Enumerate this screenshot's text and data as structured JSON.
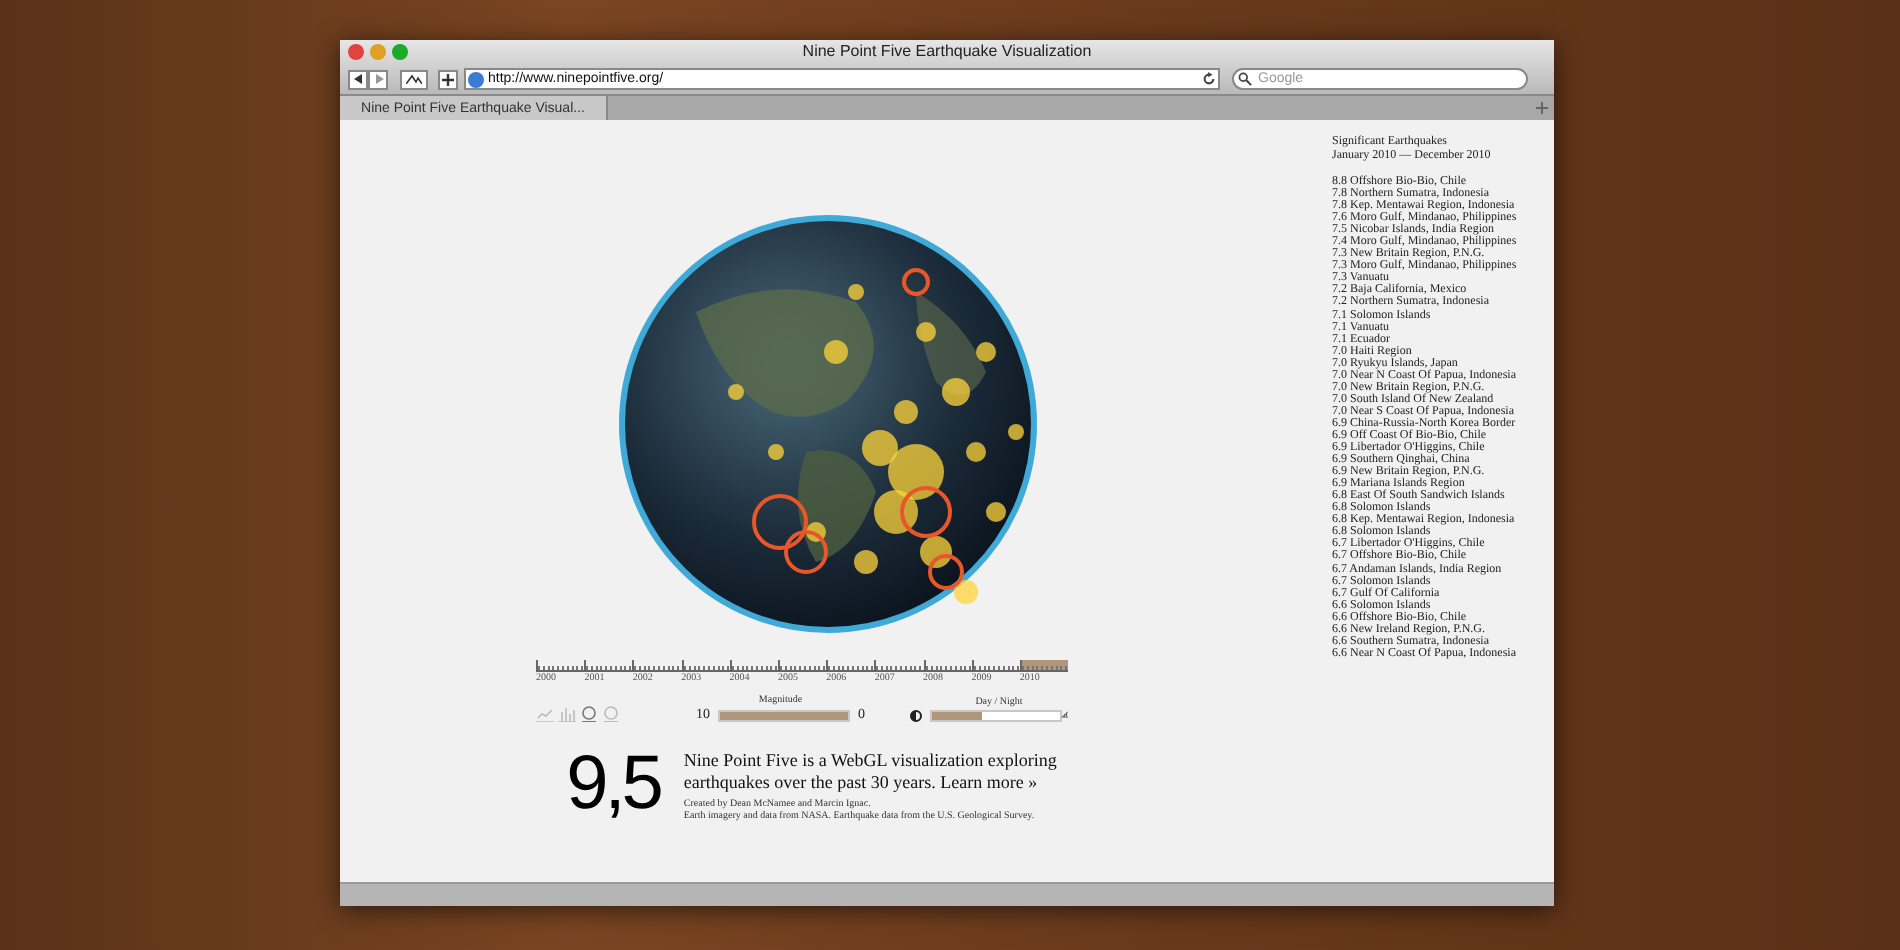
{
  "window": {
    "title": "Nine Point Five Earthquake Visualization"
  },
  "toolbar": {
    "url": "http://www.ninepointfive.org/",
    "search_placeholder": "Google"
  },
  "tabs": [
    {
      "label": "Nine Point Five Earthquake Visual...",
      "selected": true
    }
  ],
  "list": {
    "title": "Significant Earthquakes",
    "range": "January 2010 — December 2010",
    "items": [
      "8.8 Offshore Bio-Bio, Chile",
      "7.8 Northern Sumatra, Indonesia",
      "7.8 Kep. Mentawai Region, Indonesia",
      "7.6 Moro Gulf, Mindanao, Philippines",
      "7.5 Nicobar Islands, India Region",
      "7.4 Moro Gulf, Mindanao, Philippines",
      "7.3 New Britain Region, P.N.G.",
      "7.3 Moro Gulf, Mindanao, Philippines",
      "7.3 Vanuatu",
      "7.2 Baja California, Mexico",
      "7.2 Northern Sumatra, Indonesia",
      "7.1 Solomon Islands",
      "7.1 Vanuatu",
      "7.1 Ecuador",
      "7.0 Haiti Region",
      "7.0 Ryukyu Islands, Japan",
      "7.0 Near N Coast Of Papua, Indonesia",
      "7.0 New Britain Region, P.N.G.",
      "7.0 South Island Of New Zealand",
      "7.0 Near S Coast Of Papua, Indonesia",
      "6.9 China-Russia-North Korea Border",
      "6.9 Off Coast Of Bio-Bio, Chile",
      "6.9 Libertador O'Higgins, Chile",
      "6.9 Southern Qinghai, China",
      "6.9 New Britain Region, P.N.G.",
      "6.9 Mariana Islands Region",
      "6.8 East Of South Sandwich Islands",
      "6.8 Solomon Islands",
      "6.8 Kep. Mentawai Region, Indonesia",
      "6.8 Solomon Islands",
      "6.7 Libertador O'Higgins, Chile",
      "6.7 Offshore Bio-Bio, Chile",
      "6.7 Andaman Islands, India Region",
      "6.7 Solomon Islands",
      "6.7 Gulf Of California",
      "6.6 Solomon Islands",
      "6.6 Offshore Bio-Bio, Chile",
      "6.6 New Ireland Region, P.N.G.",
      "6.6 Southern Sumatra, Indonesia",
      "6.6 Near N Coast Of Papua, Indonesia"
    ]
  },
  "timeline": [
    {
      "label": "2000",
      "selected": false
    },
    {
      "label": "2001",
      "selected": false
    },
    {
      "label": "2002",
      "selected": false
    },
    {
      "label": "2003",
      "selected": false
    },
    {
      "label": "2004",
      "selected": false
    },
    {
      "label": "2005",
      "selected": false
    },
    {
      "label": "2006",
      "selected": false
    },
    {
      "label": "2007",
      "selected": false
    },
    {
      "label": "2008",
      "selected": false
    },
    {
      "label": "2009",
      "selected": false
    },
    {
      "label": "2010",
      "selected": true
    }
  ],
  "magnitude": {
    "label": "Magnitude",
    "max": "10",
    "min": "0",
    "level": 1
  },
  "day_night": {
    "label": "Day / Night",
    "level": 0.4
  },
  "about": {
    "logo": "9,5",
    "text": "Nine Point Five is a WebGL visualization exploring earthquakes over the past 30 years.",
    "link": "Learn more »",
    "credits": [
      "Created by Dean McNamee and Marcin Ignac.",
      "Earth imagery and data from NASA. Earthquake data from the U.S. Geological Survey."
    ]
  }
}
